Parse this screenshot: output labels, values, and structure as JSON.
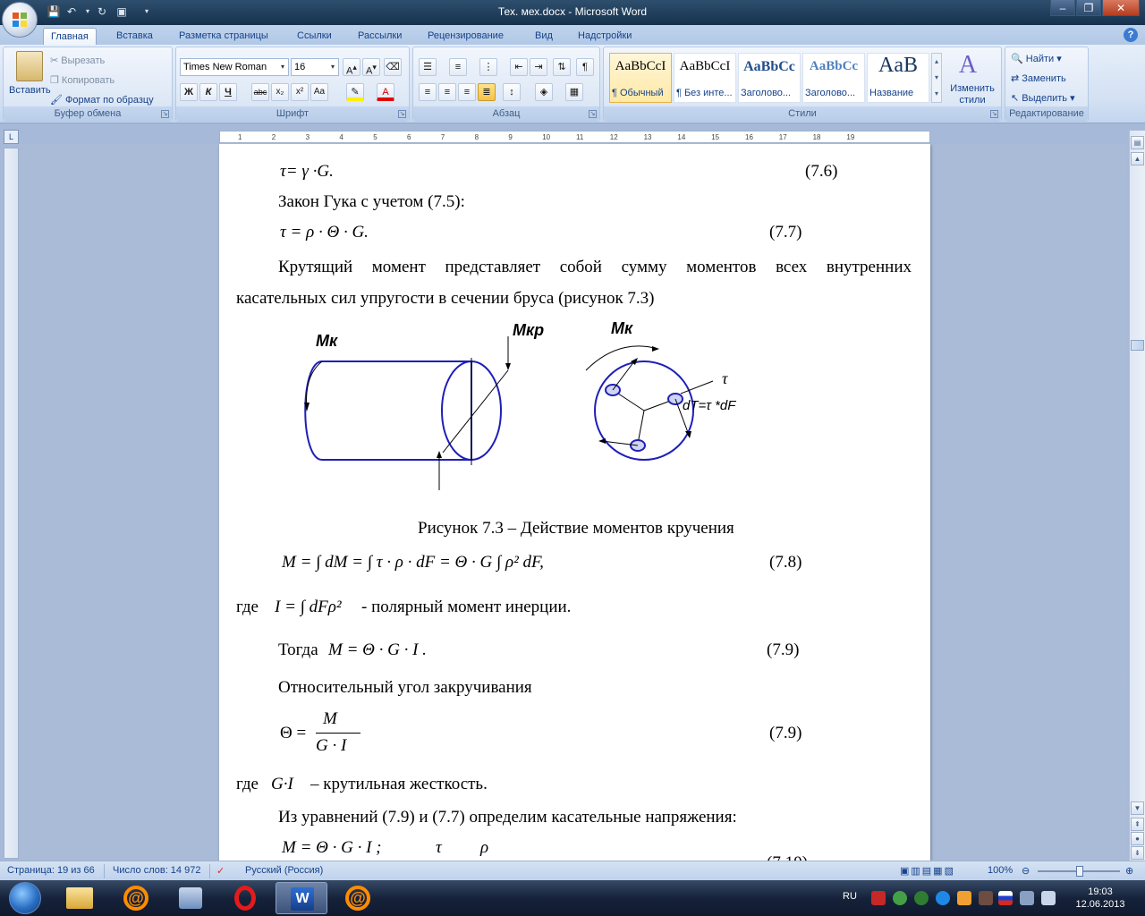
{
  "window": {
    "title": "Тех. мех.docx - Microsoft Word"
  },
  "tabs": [
    "Главная",
    "Вставка",
    "Разметка страницы",
    "Ссылки",
    "Рассылки",
    "Рецензирование",
    "Вид",
    "Надстройки"
  ],
  "clipboard": {
    "paste": "Вставить",
    "cut": "Вырезать",
    "copy": "Копировать",
    "format_painter": "Формат по образцу",
    "label": "Буфер обмена"
  },
  "font": {
    "name": "Times New Roman",
    "size": "16",
    "label": "Шрифт"
  },
  "paragraph": {
    "label": "Абзац"
  },
  "styles": {
    "items": [
      {
        "sample": "AaBbCcI",
        "name": "¶ Обычный"
      },
      {
        "sample": "AaBbCcI",
        "name": "¶ Без инте..."
      },
      {
        "sample": "AaBbCc",
        "name": "Заголово..."
      },
      {
        "sample": "AaBbCc",
        "name": "Заголово..."
      },
      {
        "sample": "AaB",
        "name": "Название"
      }
    ],
    "change_styles": "Изменить стили",
    "label": "Стили"
  },
  "editing": {
    "find": "Найти",
    "replace": "Заменить",
    "select": "Выделить",
    "label": "Редактирование"
  },
  "ruler": {
    "ticks": [
      "1",
      "2",
      "3",
      "4",
      "5",
      "6",
      "7",
      "8",
      "9",
      "10",
      "11",
      "12",
      "13",
      "14",
      "15",
      "16",
      "17",
      "18",
      "19"
    ]
  },
  "document": {
    "eq76": "τ= γ ·G.",
    "eq76_num": "(7.6)",
    "hooke": "Закон Гука с учетом (7.5):",
    "eq77": "τ = ρ · Θ · G.",
    "eq77_num": "(7.7)",
    "para1_line1": "Крутящий момент представляет собой сумму моментов всех внутренних",
    "para1_line2": "касательных сил упругости в сечении бруса (рисунок 7.3)",
    "fig_labels": {
      "mk_left": "Mк",
      "mkp": "Mкр",
      "mk_right": "Mк",
      "tau": "τ",
      "dT": "dT=τ *dF"
    },
    "caption": "Рисунок 7.3 – Действие моментов кручения",
    "eq78": "M = ∫ dM = ∫ τ · ρ · dF = Θ · G ∫ ρ² dF,",
    "eq78_num": "(7.8)",
    "polar_prefix": "где",
    "polar_eq": "I = ∫ dFρ²",
    "polar_text": "- полярный момент инерции.",
    "then_text": "Тогда",
    "eq79a": "M = Θ · G · I .",
    "eq79a_num": "(7.9)",
    "rel_angle": "Относительный угол закручивания",
    "eq79b_lhs": "Θ =",
    "eq79b_num_top": "M",
    "eq79b_den": "G · I",
    "eq79b_num": "(7.9)",
    "rigidity_prefix": "где",
    "rigidity_eq": "G·I",
    "rigidity_text": "– крутильная жесткость.",
    "from_eq": "Из уравнений (7.9) и (7.7) определим касательные напряжения:",
    "eq710": "M = Θ · G · I ;",
    "eq710_tau": "τ",
    "eq710_rho": "ρ",
    "eq710_num": "(7.10)"
  },
  "status": {
    "page": "Страница: 19 из 66",
    "words": "Число слов: 14 972",
    "language": "Русский (Россия)",
    "zoom": "100%"
  },
  "taskbar": {
    "lang": "RU",
    "time": "19:03",
    "date": "12.06.2013"
  }
}
